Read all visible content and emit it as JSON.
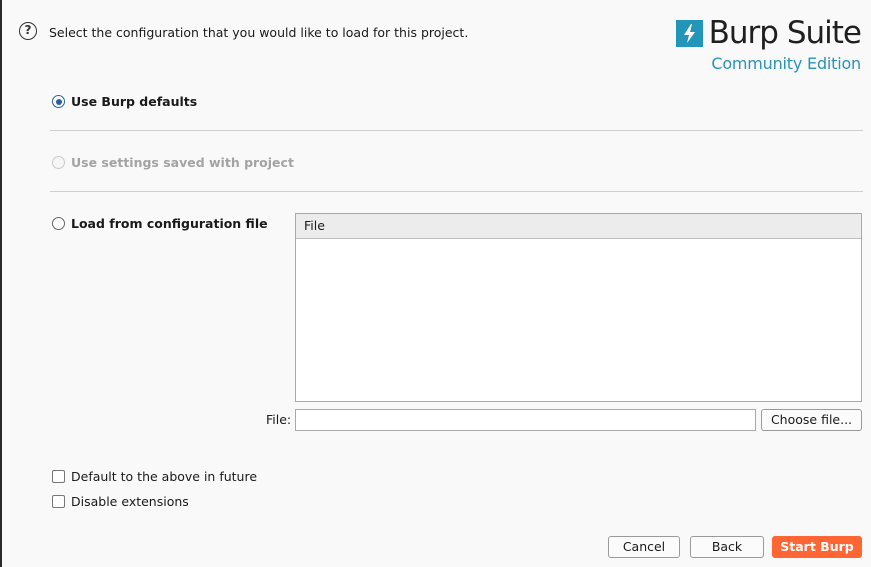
{
  "header": {
    "prompt": "Select the configuration that you would like to load for this project.",
    "help_icon": "question-circle-icon"
  },
  "logo": {
    "name": "Burp Suite",
    "edition": "Community Edition",
    "brand_color": "#2295b8"
  },
  "options": {
    "burp_defaults": {
      "label": "Use Burp defaults",
      "selected": true
    },
    "project_settings": {
      "label": "Use settings saved with project",
      "enabled": false
    },
    "config_file": {
      "label": "Load from configuration file",
      "selected": false
    }
  },
  "file_table": {
    "column_header": "File",
    "rows": []
  },
  "file_field": {
    "label": "File:",
    "value": "",
    "choose_button": "Choose file..."
  },
  "checkboxes": {
    "default_future": {
      "label": "Default to the above in future",
      "checked": false
    },
    "disable_extensions": {
      "label": "Disable extensions",
      "checked": false
    }
  },
  "buttons": {
    "cancel": "Cancel",
    "back": "Back",
    "start": "Start Burp",
    "start_color": "#ff6633"
  }
}
